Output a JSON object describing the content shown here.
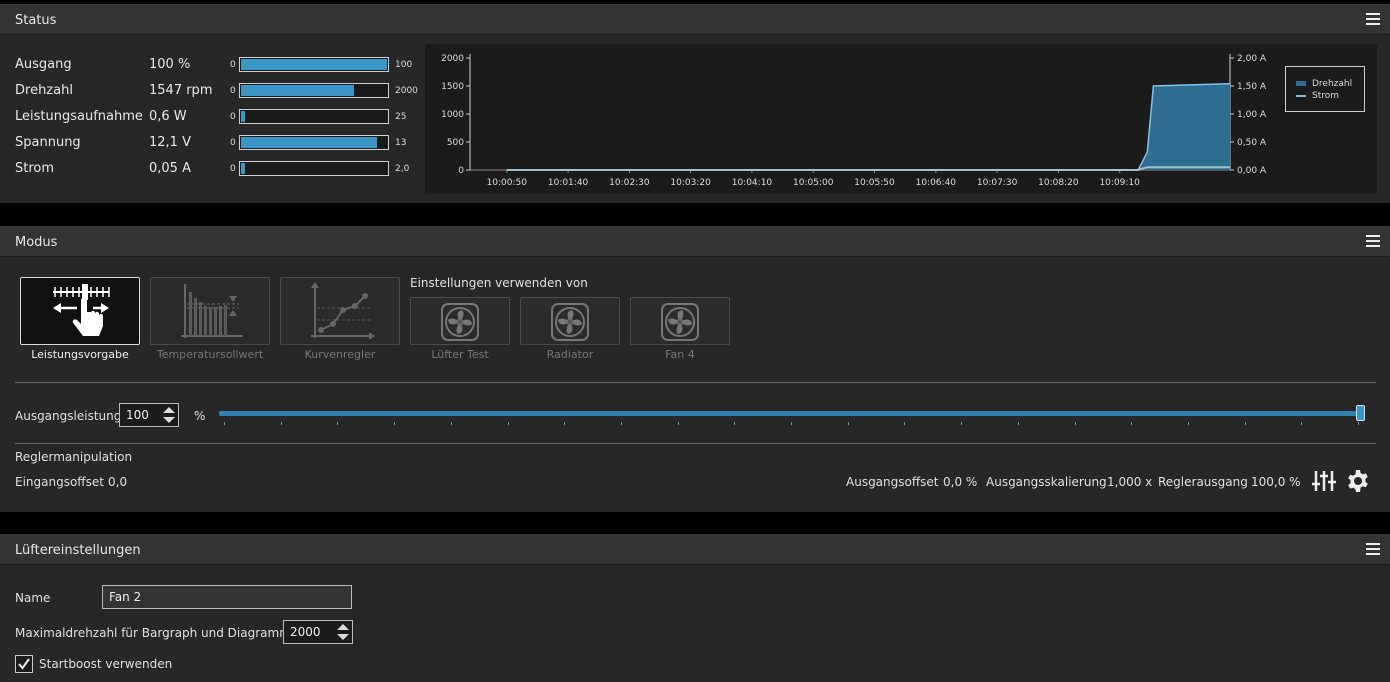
{
  "status": {
    "title": "Status",
    "rows": [
      {
        "label": "Ausgang",
        "value": "100 %",
        "min": "0",
        "max": "100",
        "fraction": 1.0
      },
      {
        "label": "Drehzahl",
        "value": "1547 rpm",
        "min": "0",
        "max": "2000",
        "fraction": 0.7735
      },
      {
        "label": "Leistungsaufnahme",
        "value": "0,6 W",
        "min": "0",
        "max": "25",
        "fraction": 0.024
      },
      {
        "label": "Spannung",
        "value": "12,1 V",
        "min": "0",
        "max": "13",
        "fraction": 0.93
      },
      {
        "label": "Strom",
        "value": "0,05 A",
        "min": "0",
        "max": "2,0",
        "fraction": 0.025
      }
    ]
  },
  "chart_data": {
    "type": "area",
    "x_ticks": [
      "10:00:50",
      "10:01:40",
      "10:02:30",
      "10:03:20",
      "10:04:10",
      "10:05:00",
      "10:05:50",
      "10:06:40",
      "10:07:30",
      "10:08:20",
      "10:09:10"
    ],
    "y_left_ticks": [
      "0",
      "500",
      "1000",
      "1500",
      "2000"
    ],
    "y_left_range": [
      0,
      2000
    ],
    "y_right_ticks": [
      "0,00 A",
      "0,50 A",
      "1,00 A",
      "1,50 A",
      "2,00 A"
    ],
    "y_right_range": [
      0,
      2
    ],
    "series": [
      {
        "name": "Drehzahl",
        "color": "#2f6d90",
        "line_color": "#7fc3e8",
        "points": [
          [
            0,
            0
          ],
          [
            10.3,
            0
          ],
          [
            10.45,
            320
          ],
          [
            10.55,
            1500
          ],
          [
            11.15,
            1520
          ],
          [
            11.8,
            1540
          ]
        ]
      },
      {
        "name": "Strom",
        "color": "#8fb8cc",
        "line_color": "#9fc0d0",
        "points": [
          [
            0,
            0
          ],
          [
            10.3,
            0
          ],
          [
            10.45,
            0.05
          ],
          [
            11.8,
            0.05
          ]
        ]
      }
    ],
    "x_range": [
      -0.6,
      11.8
    ],
    "legend_position": "top-right"
  },
  "modus": {
    "title": "Modus",
    "modes": [
      {
        "label": "Leistungsvorgabe",
        "active": true
      },
      {
        "label": "Temperatursollwert",
        "active": false
      },
      {
        "label": "Kurvenregler",
        "active": false
      }
    ],
    "source_heading": "Einstellungen verwenden von",
    "sources": [
      "Lüfter Test",
      "Radiator",
      "Fan 4"
    ],
    "output_label": "Ausgangsleistung",
    "output_value": "100",
    "output_unit": "%",
    "output_fraction": 1.0,
    "manip_heading": "Reglermanipulation",
    "input_offset_label": "Eingangsoffset",
    "input_offset_value": "0,0",
    "output_offset_label": "Ausgangsoffset",
    "output_offset_value": "0,0 %",
    "output_scale_label": "Ausgangsskalierung",
    "output_scale_value": "1,000 x",
    "controller_output_label": "Reglerausgang",
    "controller_output_value": "100,0 %"
  },
  "fan": {
    "title": "Lüftereinstellungen",
    "name_label": "Name",
    "name_value": "Fan 2",
    "maxrpm_label": "Maximaldrehzahl für Bargraph und Diagramm",
    "maxrpm_value": "2000",
    "startboost_label": "Startboost verwenden",
    "startboost_checked": true
  },
  "colors": {
    "accent": "#3b95c5",
    "panel": "#272727",
    "header": "#333333"
  }
}
